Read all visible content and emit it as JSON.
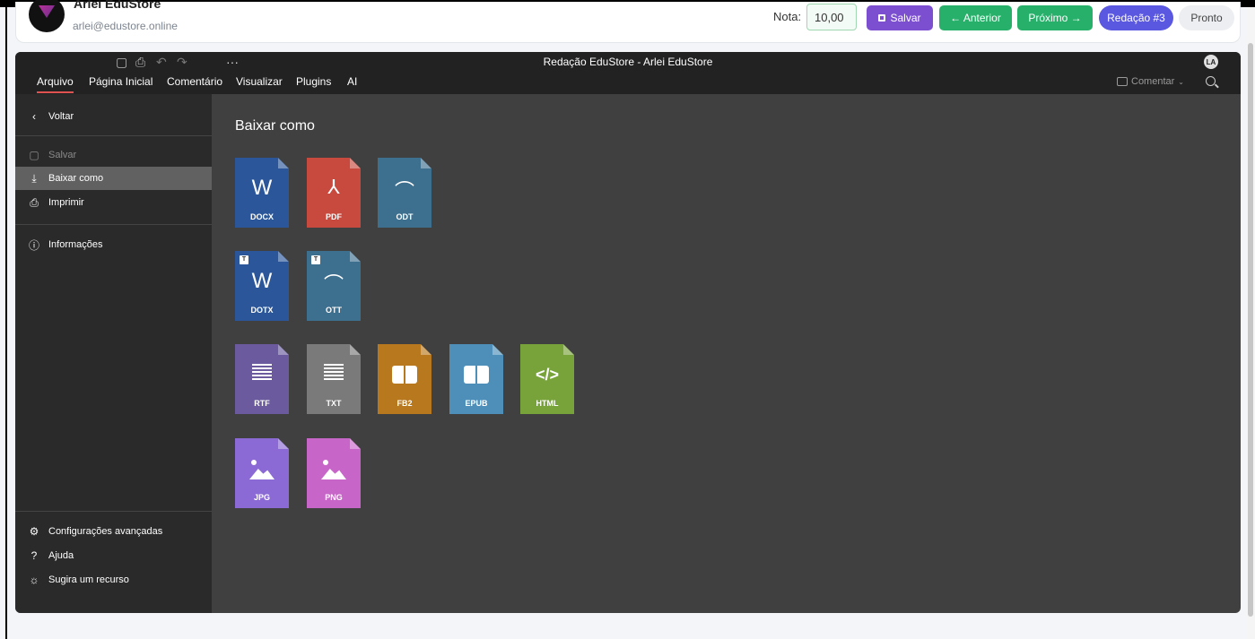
{
  "header": {
    "user_name": "Arlei EduStore",
    "user_email": "arlei@edustore.online",
    "nota_label": "Nota:",
    "nota_value": "10,00",
    "salvar": "Salvar",
    "anterior": "← Anterior",
    "proximo": "Próximo →",
    "redacao": "Redação #3",
    "pronto": "Pronto"
  },
  "editor": {
    "title": "Redação EduStore - Arlei EduStore",
    "user_initials": "LA",
    "more": "···",
    "tabs": [
      "Arquivo",
      "Página Inicial",
      "Comentário",
      "Visualizar",
      "Plugins",
      "AI"
    ],
    "comentar": "Comentar"
  },
  "sidebar": {
    "back": "Voltar",
    "items": [
      "Salvar",
      "Baixar como",
      "Imprimir",
      "Informações"
    ],
    "bottom": [
      "Configurações avançadas",
      "Ajuda",
      "Sugira um recurso"
    ]
  },
  "content": {
    "title": "Baixar como",
    "formats": [
      "DOCX",
      "PDF",
      "ODT",
      "DOTX",
      "OTT",
      "RTF",
      "TXT",
      "FB2",
      "EPUB",
      "HTML",
      "JPG",
      "PNG"
    ],
    "glyphs": {
      "word": "W",
      "html": "</>"
    },
    "template_badge": "T"
  },
  "colors": {
    "docx": "#2b579a",
    "pdf": "#c8493e",
    "odt": "#3d6f8f",
    "rtf": "#6b5b9e",
    "txt": "#7a7a7a",
    "fb2": "#b8791e",
    "epub": "#4e8fb9",
    "html": "#78a33a",
    "jpg": "#8b6ad6",
    "png": "#c865c8",
    "accent": "#e05252"
  }
}
